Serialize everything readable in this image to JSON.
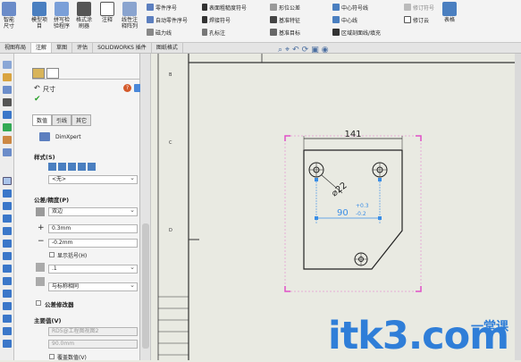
{
  "ribbon": {
    "big_buttons": [
      "智能尺寸",
      "模型项目",
      "拼写检验程序",
      "格式涂刷器",
      "注释",
      "线性注释阵列"
    ],
    "col1": [
      "零件序号",
      "自动零件序号",
      "磁力线"
    ],
    "col2": [
      "表面粗糙度符号",
      "焊接符号",
      "孔标注"
    ],
    "col3": [
      "形位公差",
      "基准特征",
      "基准目标"
    ],
    "col4": [
      "中心符号线",
      "中心线",
      "区域剖面线/填充"
    ],
    "col5": [
      "修订符号",
      "修订云"
    ],
    "table_label": "表格"
  },
  "tabs": [
    "视图布局",
    "注解",
    "草图",
    "评估",
    "SOLIDWORKS 插件",
    "图纸格式"
  ],
  "active_tab_index": 1,
  "panel": {
    "title": "尺寸",
    "subtabs": [
      "数值",
      "引线",
      "其它"
    ],
    "dimxpert": "DimXpert",
    "style_header": "样式(S)",
    "style_value": "<无>",
    "tolerance_header": "公差/精度(P)",
    "tolerance_type": "双边",
    "plus_value": "0.3mm",
    "minus_value": "-0.2mm",
    "show_paren": "显示括号(H)",
    "precision_value": ".1",
    "precision_same": "与标称相同",
    "modifier_header": "公差修改器",
    "main_value_header": "主要值(V)",
    "main_value_ref": "RD5@工程图视图2",
    "main_value": "90.0mm",
    "override": "覆盖数值(V)"
  },
  "drawing": {
    "dim_width": "141",
    "dim_diameter": "⌀22",
    "dim_hole": "90",
    "tol_plus": "+0.3",
    "tol_minus": "-0.2"
  },
  "watermark": {
    "text": "itk3.com",
    "cn": "一堂课"
  },
  "colors": {
    "accent": "#2f7ed8",
    "selection": "#e050c8",
    "dim": "#3a8ee6"
  }
}
